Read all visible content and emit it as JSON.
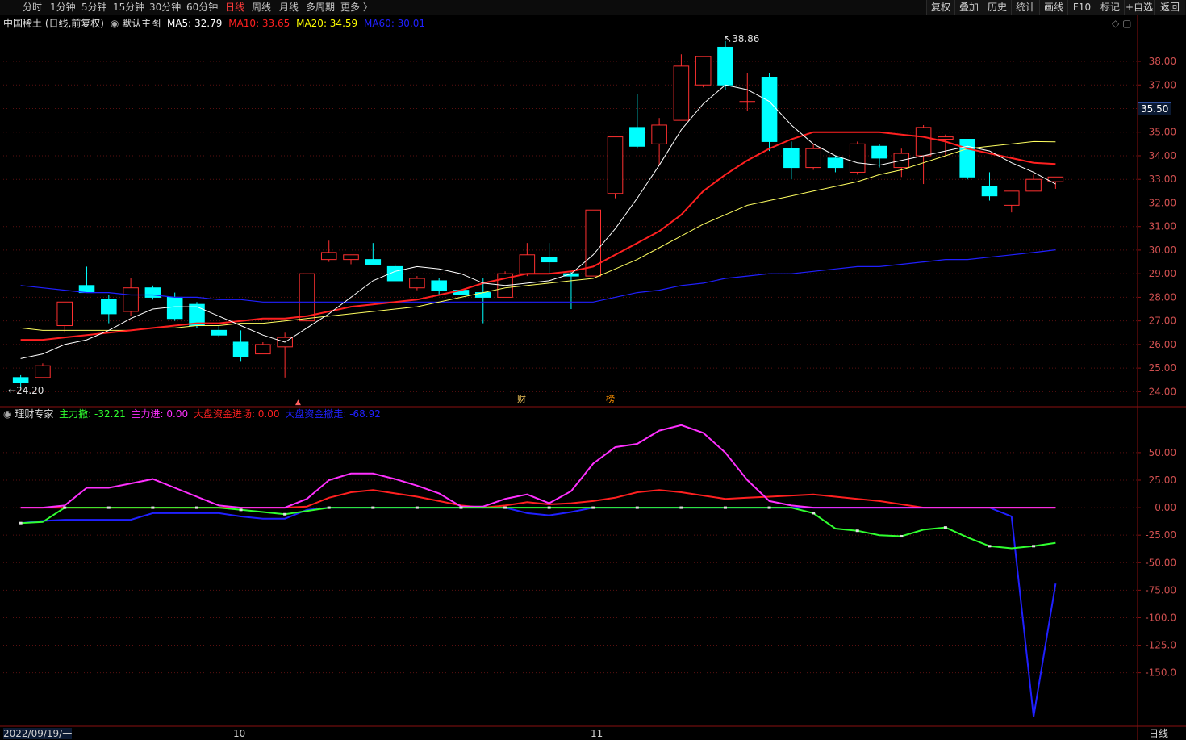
{
  "toolbar": {
    "tabs": [
      "分时",
      "1分钟",
      "5分钟",
      "15分钟",
      "30分钟",
      "60分钟",
      "日线",
      "周线",
      "月线",
      "多周期",
      "更多 〉"
    ],
    "active_tab": "日线",
    "right_buttons": [
      "复权",
      "叠加",
      "历史",
      "统计",
      "画线",
      "F10",
      "标记",
      "+自选",
      "返回"
    ]
  },
  "main_panel": {
    "stock_title": "中国稀土 (日线,前复权)",
    "template_label": "默认主图",
    "ma": [
      {
        "label": "MA5: 32.79",
        "color": "#ffffff"
      },
      {
        "label": "MA10: 33.65",
        "color": "#ff2020"
      },
      {
        "label": "MA20: 34.59",
        "color": "#ffff00"
      },
      {
        "label": "MA60: 30.01",
        "color": "#2020ff"
      }
    ],
    "high_label": "38.86",
    "low_label": "24.20",
    "current_price_label": "35.50",
    "event_markers": [
      "财",
      "榜"
    ]
  },
  "sub_panel": {
    "indicator_name": "理财专家",
    "series_labels": [
      {
        "label": "主力撤: -32.21",
        "color": "#30ff30"
      },
      {
        "label": "主力进: 0.00",
        "color": "#ff30ff"
      },
      {
        "label": "大盘资金进场: 0.00",
        "color": "#ff2020"
      },
      {
        "label": "大盘资金撤走: -68.92",
        "color": "#2020ff"
      }
    ]
  },
  "bottom_axis": {
    "start_date": "2022/09/19/一",
    "month_labels": [
      "10",
      "11"
    ],
    "period_label": "日线"
  },
  "chart_data": [
    {
      "type": "candlestick",
      "ylim": [
        23.5,
        39.3
      ],
      "yticks": [
        24,
        25,
        26,
        27,
        28,
        29,
        30,
        31,
        32,
        33,
        34,
        35,
        36,
        37,
        38
      ],
      "ytick_labels": [
        "24.00",
        "25.00",
        "26.00",
        "27.00",
        "28.00",
        "29.00",
        "30.00",
        "31.00",
        "32.00",
        "33.00",
        "34.00",
        "35.00",
        "",
        "37.00",
        "38.00"
      ],
      "candles": [
        {
          "o": 24.6,
          "h": 24.7,
          "l": 24.2,
          "c": 24.4
        },
        {
          "o": 24.6,
          "h": 25.2,
          "l": 24.6,
          "c": 25.1
        },
        {
          "o": 26.8,
          "h": 27.8,
          "l": 26.5,
          "c": 27.8
        },
        {
          "o": 28.5,
          "h": 29.3,
          "l": 28.2,
          "c": 28.2
        },
        {
          "o": 27.9,
          "h": 28.1,
          "l": 26.9,
          "c": 27.3
        },
        {
          "o": 27.4,
          "h": 28.8,
          "l": 27.2,
          "c": 28.4
        },
        {
          "o": 28.4,
          "h": 28.5,
          "l": 27.9,
          "c": 28.0
        },
        {
          "o": 28.0,
          "h": 28.2,
          "l": 27.0,
          "c": 27.1
        },
        {
          "o": 27.7,
          "h": 27.8,
          "l": 26.7,
          "c": 26.8
        },
        {
          "o": 26.6,
          "h": 26.8,
          "l": 26.3,
          "c": 26.4
        },
        {
          "o": 26.1,
          "h": 26.6,
          "l": 25.3,
          "c": 25.5
        },
        {
          "o": 25.6,
          "h": 26.1,
          "l": 25.6,
          "c": 26.0
        },
        {
          "o": 25.9,
          "h": 26.5,
          "l": 24.6,
          "c": 26.3
        },
        {
          "o": 27.0,
          "h": 29.0,
          "l": 26.9,
          "c": 29.0
        },
        {
          "o": 29.6,
          "h": 30.4,
          "l": 29.5,
          "c": 29.9
        },
        {
          "o": 29.6,
          "h": 29.8,
          "l": 29.4,
          "c": 29.8
        },
        {
          "o": 29.6,
          "h": 30.3,
          "l": 29.4,
          "c": 29.4
        },
        {
          "o": 29.3,
          "h": 29.4,
          "l": 28.7,
          "c": 28.7
        },
        {
          "o": 28.4,
          "h": 28.9,
          "l": 28.3,
          "c": 28.8
        },
        {
          "o": 28.7,
          "h": 28.8,
          "l": 28.1,
          "c": 28.3
        },
        {
          "o": 28.3,
          "h": 29.1,
          "l": 28.0,
          "c": 28.1
        },
        {
          "o": 28.2,
          "h": 28.8,
          "l": 26.9,
          "c": 28.0
        },
        {
          "o": 28.0,
          "h": 29.1,
          "l": 28.0,
          "c": 29.0
        },
        {
          "o": 29.0,
          "h": 30.3,
          "l": 28.9,
          "c": 29.8
        },
        {
          "o": 29.7,
          "h": 30.3,
          "l": 29.0,
          "c": 29.5
        },
        {
          "o": 29.0,
          "h": 29.1,
          "l": 27.5,
          "c": 28.9
        },
        {
          "o": 28.9,
          "h": 31.7,
          "l": 28.9,
          "c": 31.7
        },
        {
          "o": 32.4,
          "h": 34.8,
          "l": 32.2,
          "c": 34.8
        },
        {
          "o": 35.2,
          "h": 36.6,
          "l": 34.3,
          "c": 34.4
        },
        {
          "o": 34.5,
          "h": 35.6,
          "l": 33.6,
          "c": 35.3
        },
        {
          "o": 35.5,
          "h": 38.3,
          "l": 35.5,
          "c": 37.8
        },
        {
          "o": 37.0,
          "h": 38.2,
          "l": 36.9,
          "c": 38.2
        },
        {
          "o": 38.6,
          "h": 38.86,
          "l": 36.8,
          "c": 37.0
        },
        {
          "o": 36.3,
          "h": 37.5,
          "l": 35.9,
          "c": 36.3
        },
        {
          "o": 37.3,
          "h": 37.5,
          "l": 34.2,
          "c": 34.6
        },
        {
          "o": 34.3,
          "h": 34.6,
          "l": 33.0,
          "c": 33.5
        },
        {
          "o": 33.5,
          "h": 34.5,
          "l": 33.4,
          "c": 34.3
        },
        {
          "o": 33.9,
          "h": 34.0,
          "l": 33.3,
          "c": 33.5
        },
        {
          "o": 33.3,
          "h": 34.6,
          "l": 33.2,
          "c": 34.5
        },
        {
          "o": 34.4,
          "h": 34.5,
          "l": 33.5,
          "c": 33.9
        },
        {
          "o": 33.5,
          "h": 34.3,
          "l": 33.1,
          "c": 34.1
        },
        {
          "o": 34.0,
          "h": 35.3,
          "l": 32.8,
          "c": 35.2
        },
        {
          "o": 34.7,
          "h": 34.9,
          "l": 34.0,
          "c": 34.8
        },
        {
          "o": 34.7,
          "h": 34.7,
          "l": 33.0,
          "c": 33.1
        },
        {
          "o": 32.7,
          "h": 33.3,
          "l": 32.1,
          "c": 32.3
        },
        {
          "o": 31.9,
          "h": 32.5,
          "l": 31.6,
          "c": 32.5
        },
        {
          "o": 32.5,
          "h": 33.2,
          "l": 32.5,
          "c": 33.0
        },
        {
          "o": 32.9,
          "h": 33.1,
          "l": 32.6,
          "c": 33.1
        }
      ],
      "ma5": [
        25.4,
        25.6,
        26.0,
        26.2,
        26.6,
        27.1,
        27.5,
        27.6,
        27.6,
        27.2,
        26.8,
        26.4,
        26.1,
        26.7,
        27.3,
        28.0,
        28.7,
        29.1,
        29.3,
        29.2,
        29.0,
        28.6,
        28.5,
        28.6,
        28.7,
        29.0,
        29.8,
        30.9,
        32.2,
        33.6,
        35.1,
        36.2,
        37.0,
        36.8,
        36.3,
        35.3,
        34.5,
        34.0,
        33.7,
        33.6,
        33.8,
        34.0,
        34.2,
        34.4,
        34.2,
        33.7,
        33.3,
        32.8
      ],
      "ma10": [
        26.2,
        26.2,
        26.3,
        26.4,
        26.5,
        26.6,
        26.7,
        26.8,
        26.9,
        26.9,
        27.0,
        27.1,
        27.1,
        27.2,
        27.4,
        27.6,
        27.7,
        27.8,
        27.9,
        28.1,
        28.3,
        28.6,
        28.8,
        29.0,
        29.0,
        29.1,
        29.3,
        29.8,
        30.3,
        30.8,
        31.5,
        32.5,
        33.2,
        33.8,
        34.3,
        34.7,
        35.0,
        35.0,
        35.0,
        35.0,
        34.9,
        34.8,
        34.6,
        34.3,
        34.1,
        33.9,
        33.7,
        33.65
      ],
      "ma20": [
        26.7,
        26.6,
        26.6,
        26.6,
        26.6,
        26.6,
        26.7,
        26.7,
        26.8,
        26.8,
        26.9,
        26.9,
        27.0,
        27.1,
        27.2,
        27.3,
        27.4,
        27.5,
        27.6,
        27.8,
        28.0,
        28.2,
        28.4,
        28.5,
        28.6,
        28.7,
        28.8,
        29.2,
        29.6,
        30.1,
        30.6,
        31.1,
        31.5,
        31.9,
        32.1,
        32.3,
        32.5,
        32.7,
        32.9,
        33.2,
        33.4,
        33.7,
        34.0,
        34.3,
        34.4,
        34.5,
        34.6,
        34.59
      ],
      "ma60": [
        28.5,
        28.4,
        28.3,
        28.2,
        28.2,
        28.1,
        28.1,
        28.0,
        28.0,
        27.9,
        27.9,
        27.8,
        27.8,
        27.8,
        27.8,
        27.8,
        27.8,
        27.8,
        27.8,
        27.8,
        27.8,
        27.8,
        27.8,
        27.8,
        27.8,
        27.8,
        27.8,
        28.0,
        28.2,
        28.3,
        28.5,
        28.6,
        28.8,
        28.9,
        29.0,
        29.0,
        29.1,
        29.2,
        29.3,
        29.3,
        29.4,
        29.5,
        29.6,
        29.6,
        29.7,
        29.8,
        29.9,
        30.01
      ]
    },
    {
      "type": "line",
      "ylim": [
        -195,
        80
      ],
      "yticks": [
        50,
        25,
        0,
        -25,
        -50,
        -75,
        -100,
        -125,
        -150
      ],
      "ytick_labels": [
        "50.00",
        "25.00",
        "0.00",
        "-25.00",
        "-50.00",
        "-75.00",
        "-100.0",
        "-125.0",
        "-150.0"
      ],
      "series": [
        {
          "name": "主力撤",
          "color": "#30ff30",
          "values": [
            -14,
            -13,
            0,
            0,
            0,
            0,
            0,
            0,
            0,
            0,
            -2,
            -4,
            -6,
            -3,
            0,
            0,
            0,
            0,
            0,
            0,
            0,
            0,
            0,
            0,
            0,
            0,
            0,
            0,
            0,
            0,
            0,
            0,
            0,
            0,
            0,
            0,
            -5,
            -19,
            -21,
            -25,
            -26,
            -20,
            -18,
            -27,
            -35,
            -37,
            -35,
            -32
          ]
        },
        {
          "name": "主力进",
          "color": "#ff30ff",
          "values": [
            0,
            0,
            2,
            18,
            18,
            22,
            26,
            18,
            10,
            2,
            0,
            0,
            0,
            8,
            25,
            31,
            31,
            26,
            20,
            13,
            1,
            1,
            8,
            12,
            4,
            15,
            40,
            55,
            58,
            70,
            75,
            68,
            50,
            25,
            6,
            2,
            0,
            0,
            0,
            0,
            0,
            0,
            0,
            0,
            0,
            0,
            0,
            0
          ]
        },
        {
          "name": "大盘资金进场",
          "color": "#ff2020",
          "values": [
            0,
            0,
            0,
            0,
            0,
            0,
            0,
            0,
            0,
            0,
            0,
            0,
            0,
            1,
            9,
            14,
            16,
            13,
            10,
            6,
            2,
            0,
            2,
            5,
            3,
            4,
            6,
            9,
            14,
            16,
            14,
            11,
            8,
            9,
            10,
            11,
            12,
            10,
            8,
            6,
            3,
            0,
            0,
            0,
            0,
            0,
            0,
            0
          ]
        },
        {
          "name": "大盘资金撤走",
          "color": "#2020ff",
          "values": [
            -14,
            -12,
            -11,
            -11,
            -11,
            -11,
            -5,
            -5,
            -5,
            -5,
            -8,
            -10,
            -10,
            -2,
            0,
            0,
            0,
            0,
            0,
            0,
            0,
            0,
            0,
            -5,
            -7,
            -4,
            0,
            0,
            0,
            0,
            0,
            0,
            0,
            0,
            0,
            0,
            0,
            0,
            0,
            0,
            0,
            0,
            0,
            0,
            0,
            -8,
            -190,
            -69
          ]
        }
      ]
    }
  ]
}
